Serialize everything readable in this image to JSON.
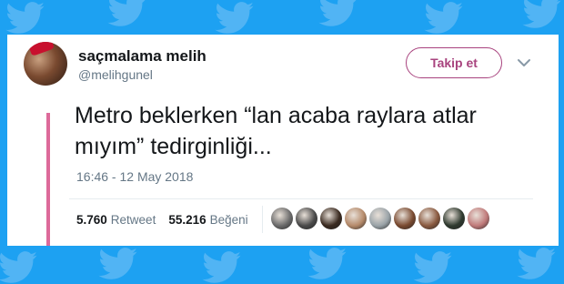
{
  "tweet": {
    "display_name": "saçmalama melih",
    "handle": "@melihgunel",
    "follow_label": "Takip et",
    "text_line1": "Metro beklerken “lan acaba raylara atlar",
    "text_line2": "mıyım” tedirginliği...",
    "timestamp": "16:46 - 12 May 2018",
    "retweet_count": "5.760",
    "retweet_label": "Retweet",
    "like_count": "55.216",
    "like_label": "Beğeni"
  },
  "colors": {
    "background": "#1da1f2",
    "accent": "#a8437e",
    "thread_line": "#dd6a9a",
    "liker_avatars": [
      "#6b6b6b",
      "#4a4a4a",
      "#3a2a20",
      "#b58a6a",
      "#9aa3a8",
      "#7a4a30",
      "#8a5a40",
      "#2f3a2f",
      "#c07a7a"
    ]
  },
  "icons": {
    "background_pattern": "twitter-bird-icon",
    "menu": "chevron-down-icon"
  }
}
